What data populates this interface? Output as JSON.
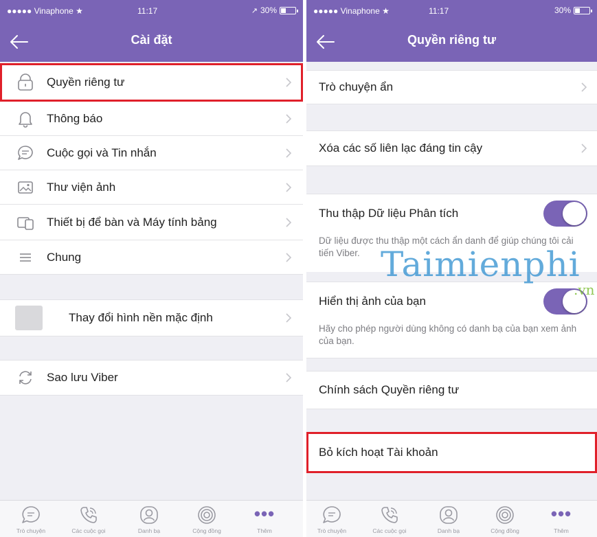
{
  "left_screen": {
    "status": {
      "carrier": "●●●●● Vinaphone ★",
      "time": "11:17",
      "battery": "30%",
      "battery_level": 0.3
    },
    "title": "Cài đặt",
    "settings_items": [
      {
        "label": "Quyền riêng tư",
        "icon": "lock-icon"
      },
      {
        "label": "Thông báo",
        "icon": "bell-icon"
      },
      {
        "label": "Cuộc gọi và Tin nhắn",
        "icon": "chat-bubble-icon"
      },
      {
        "label": "Thư viện ảnh",
        "icon": "image-icon"
      },
      {
        "label": "Thiết bị để bàn và Máy tính bảng",
        "icon": "devices-icon"
      },
      {
        "label": "Chung",
        "icon": "list-icon"
      }
    ],
    "wallpaper_label": "Thay đổi hình nền mặc định",
    "backup_label": "Sao lưu Viber"
  },
  "right_screen": {
    "status": {
      "carrier": "●●●●● Vinaphone ★",
      "time": "11:17",
      "battery": "30%",
      "battery_level": 0.3
    },
    "title": "Quyền riêng tư",
    "hidden_chats": "Trò chuyện ẩn",
    "clear_trusted": "Xóa các số liên lạc đáng tin cậy",
    "analytics": {
      "label": "Thu thập Dữ liệu Phân tích",
      "enabled": true,
      "description": "Dữ liệu được thu thập một cách ẩn danh để giúp chúng tôi cải tiến Viber."
    },
    "show_photo": {
      "label": "Hiển thị ảnh của bạn",
      "enabled": true,
      "description": "Hãy cho phép người dùng không có danh bạ của bạn xem ảnh của bạn."
    },
    "privacy_policy": "Chính sách Quyền riêng tư",
    "deactivate": "Bỏ kích hoạt Tài khoản"
  },
  "tab_bar": [
    {
      "label": "Trò chuyện",
      "icon": "chat-icon"
    },
    {
      "label": "Các cuộc gọi",
      "icon": "phone-icon"
    },
    {
      "label": "Danh bạ",
      "icon": "contacts-icon"
    },
    {
      "label": "Cộng đồng",
      "icon": "community-icon"
    },
    {
      "label": "Thêm",
      "icon": "more-icon"
    }
  ],
  "watermark": {
    "main": "Taimienphi",
    "sub": ".vn"
  },
  "colors": {
    "brand": "#7a64b6",
    "highlight": "#e0202a",
    "background": "#efeff4"
  }
}
